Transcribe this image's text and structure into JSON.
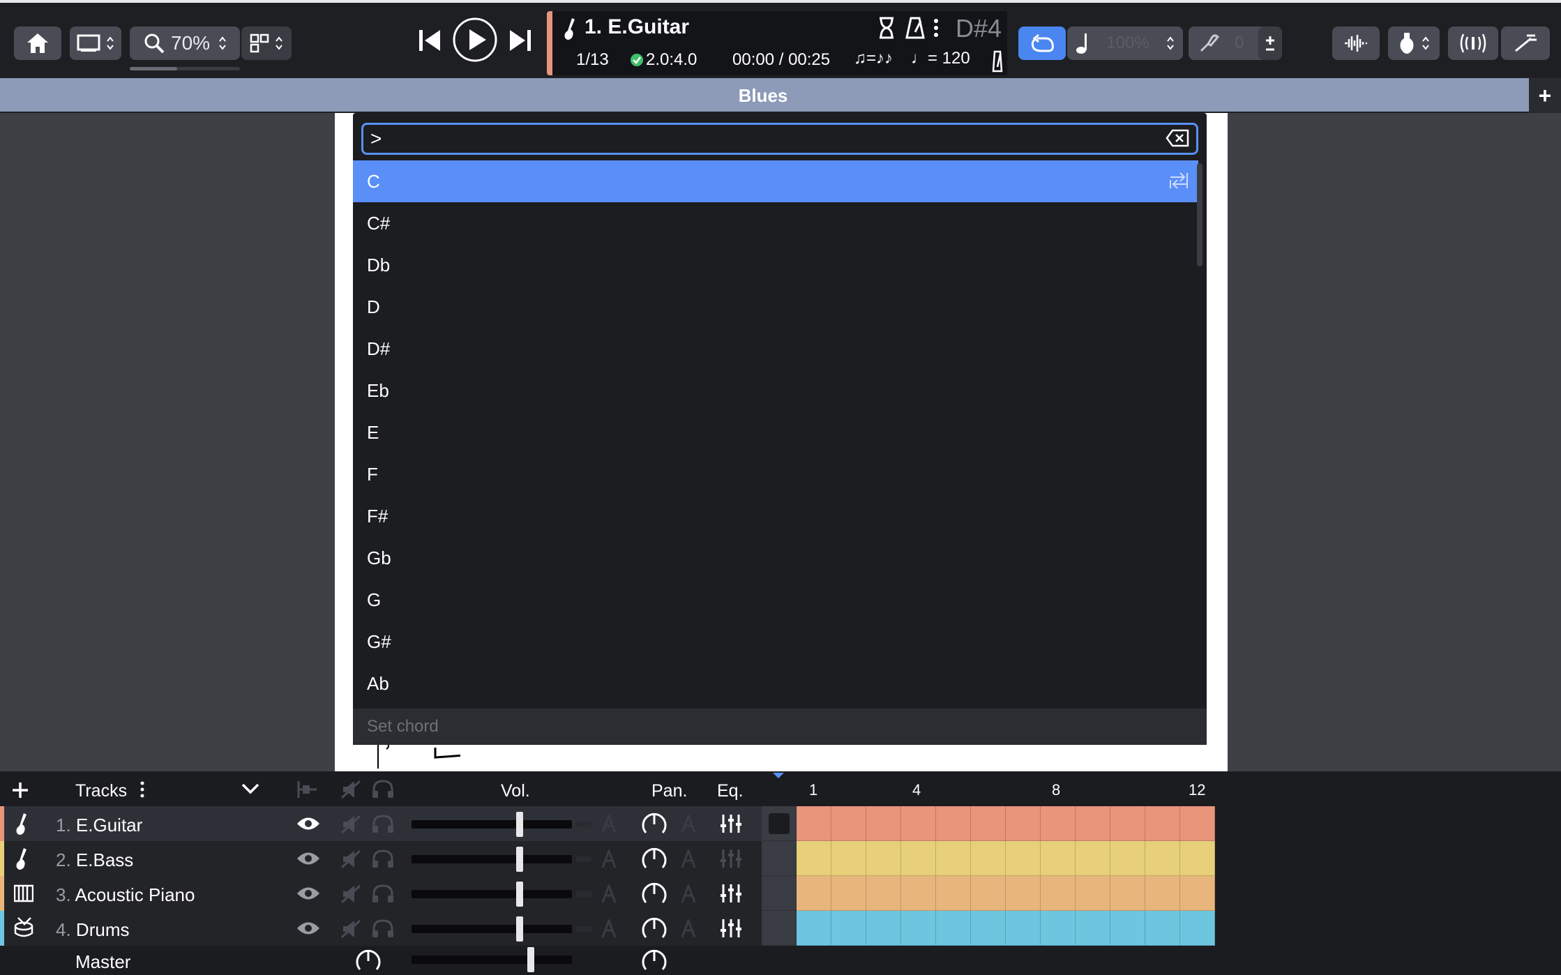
{
  "toolbar": {
    "zoom_label": "70%",
    "track_title": "1. E.Guitar",
    "bar_position": "1/13",
    "beat_position": "2.0:4.0",
    "time": "00:00 / 00:25",
    "swing_label": "♫=♪♪",
    "tempo": "= 120",
    "pitch_label": "D#4",
    "playback_speed": "100%",
    "transpose": "0"
  },
  "display": {
    "title": "Blues",
    "add_label": "+"
  },
  "palette": {
    "search_value": ">",
    "items": [
      "C",
      "C#",
      "Db",
      "D",
      "D#",
      "Eb",
      "E",
      "F",
      "F#",
      "Gb",
      "G",
      "G#",
      "Ab"
    ],
    "selected_index": 0,
    "footer": "Set chord"
  },
  "tracks": {
    "header": "Tracks",
    "vol_label": "Vol.",
    "pan_label": "Pan.",
    "eq_label": "Eq.",
    "bar_numbers": [
      "1",
      "4",
      "8",
      "12"
    ],
    "rows": [
      {
        "num": "1.",
        "name": "E.Guitar",
        "color": "#e8957c"
      },
      {
        "num": "2.",
        "name": "E.Bass",
        "color": "#e8d07a"
      },
      {
        "num": "3.",
        "name": "Acoustic Piano",
        "color": "#e8b67c"
      },
      {
        "num": "4.",
        "name": "Drums",
        "color": "#6cc6e0"
      }
    ],
    "master_label": "Master"
  }
}
